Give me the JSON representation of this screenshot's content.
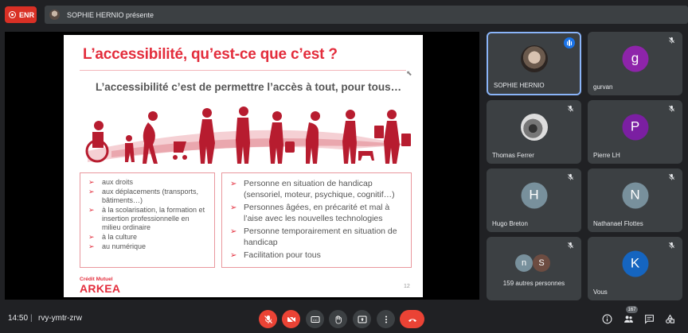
{
  "topbar": {
    "rec_label": "ENR",
    "presenter_text": "SOPHIE HERNIO présente"
  },
  "slide": {
    "title": "L’accessibilité, qu’est-ce que c’est ?",
    "subtitle": "L’accessibilité c’est de permettre l’accès à tout, pour tous…",
    "left_box": [
      "aux droits",
      "aux déplacements (transports, bâtiments…)",
      "à la scolarisation, la formation et insertion professionnelle en milieu ordinaire",
      "à la culture",
      "au numérique"
    ],
    "right_box": [
      "Personne en situation de handicap (sensoriel, moteur, psychique, cognitif…)",
      "Personnes âgées, en précarité et mal à l’aise avec les nouvelles technologies",
      "Personne temporairement en situation de handicap",
      "Facilitation pour tous"
    ],
    "bullet_glyph": "➢",
    "brand_top": "Crédit Mutuel",
    "brand_main": "ARKEA",
    "page_number": "12",
    "accent_color": "#e32d3c"
  },
  "participants": [
    {
      "name": "SOPHIE HERNIO",
      "type": "photo",
      "speaking": true
    },
    {
      "name": "gurvan",
      "initial": "g",
      "color": "#8e24aa"
    },
    {
      "name": "Thomas Ferrer",
      "type": "photo"
    },
    {
      "name": "Pierre LH",
      "initial": "P",
      "color": "#7b1fa2"
    },
    {
      "name": "Hugo Breton",
      "initial": "H",
      "color": "#78909c"
    },
    {
      "name": "Nathanael Flottes",
      "initial": "N",
      "color": "#78909c"
    },
    {
      "name": "159 autres personnes",
      "initials": [
        "n",
        "S"
      ],
      "colors": [
        "#78909c",
        "#6d4c41"
      ]
    },
    {
      "name": "Vous",
      "initial": "K",
      "color": "#1565c0"
    }
  ],
  "bottombar": {
    "time": "14:50",
    "separator": "|",
    "meeting_code": "rvy-ymtr-zrw",
    "participant_count": "167"
  }
}
